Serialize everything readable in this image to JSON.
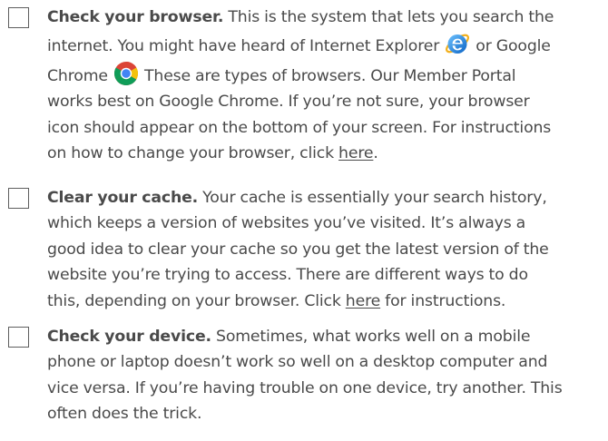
{
  "items": [
    {
      "title": "Check your browser.",
      "line1_rest": " This is the system that lets you search the",
      "line2_pre": "internet. You might have heard of Internet Explorer",
      "line2_post": " or Google",
      "line3_pre": "Chrome",
      "line3_post": " These are types of browsers. Our Member Portal",
      "line4": "works best on Google Chrome. If you’re not sure, your browser",
      "line5": "icon should appear on the bottom of your screen. For instructions",
      "line6_pre": "on how to change your browser, click ",
      "link": "here",
      "line6_post": ".",
      "icons": [
        "internet-explorer-icon",
        "google-chrome-icon"
      ]
    },
    {
      "title": "Clear your cache.",
      "line1_rest": " Your cache is essentially your search history,",
      "line2": "which keeps a version of websites you’ve visited. It’s always a",
      "line3": "good idea to clear your cache so you get the latest version of the",
      "line4": "website you’re trying to access. There are different ways to do",
      "line5_pre": "this, depending on your browser. Click ",
      "link": "here",
      "line5_post": " for instructions."
    },
    {
      "title": "Check your device.",
      "line1_rest": " Sometimes, what works well on a mobile",
      "line2": "phone or laptop doesn’t work so well on a desktop computer and",
      "line3": "vice versa. If you’re having trouble on one device, try another. This",
      "line4": "often does the trick."
    }
  ],
  "colors": {
    "text": "#4a4a4a",
    "checkbox_border": "#5e5e5e",
    "ie_blue": "#1e8fe0",
    "chrome_red": "#db4437",
    "chrome_yellow": "#f4c20d",
    "chrome_green": "#0f9d58",
    "chrome_blue": "#4285f4"
  }
}
